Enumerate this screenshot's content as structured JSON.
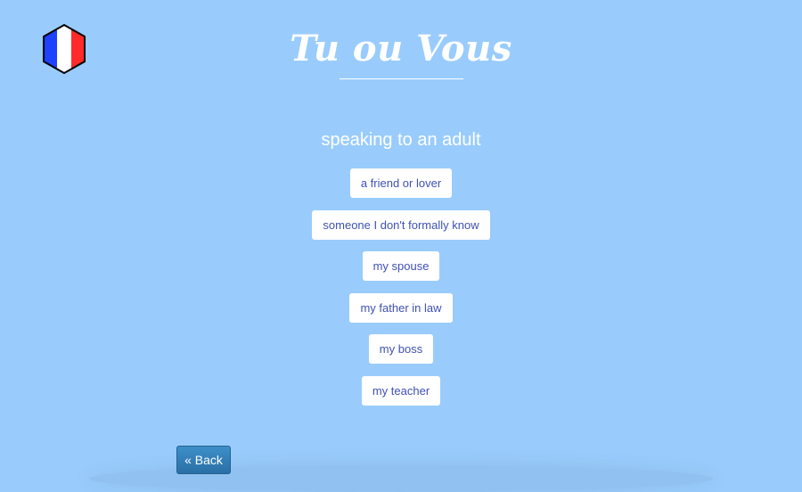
{
  "header": {
    "title": "Tu ou Vous",
    "logo_icon": "french-flag-hexagon-icon"
  },
  "question": {
    "text": "speaking to an adult"
  },
  "options": [
    {
      "label": "a friend or lover"
    },
    {
      "label": "someone I don't formally know"
    },
    {
      "label": "my spouse"
    },
    {
      "label": "my father in law"
    },
    {
      "label": "my boss"
    },
    {
      "label": "my teacher"
    }
  ],
  "navigation": {
    "back_label": "« Back"
  },
  "colors": {
    "background": "#99ccfd",
    "option_text": "#3f51b5",
    "back_button": "#2f79b4",
    "flag_blue": "#1e40ff",
    "flag_red": "#ff2a2a"
  }
}
